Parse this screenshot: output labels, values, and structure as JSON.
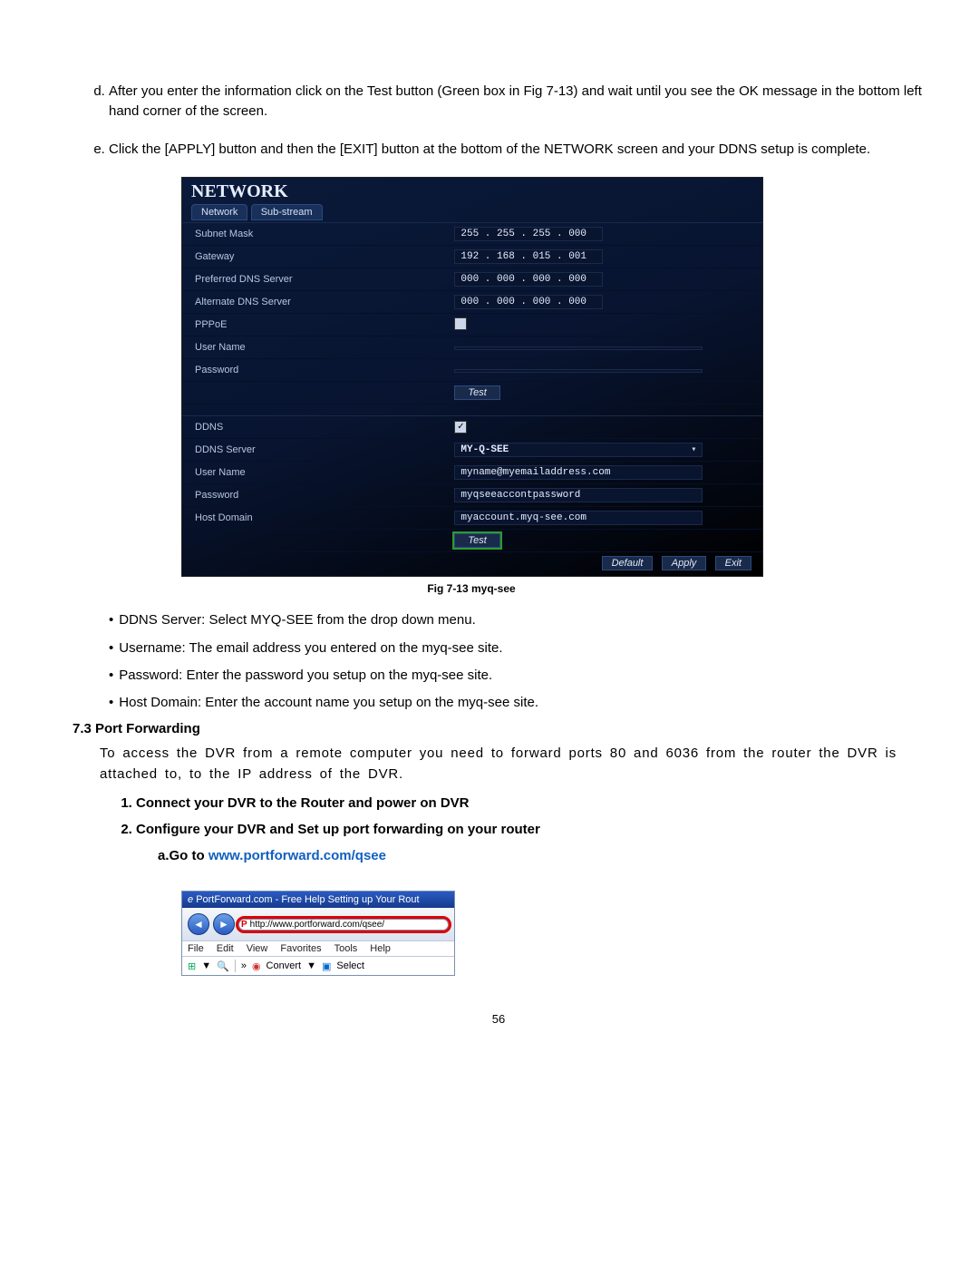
{
  "steps": {
    "d": "After you enter the information click on the Test button (Green box in Fig 7-13) and wait until you see the OK message in the bottom left hand corner of the screen.",
    "e": "Click the [APPLY] button and then the [EXIT] button at the bottom of the NETWORK screen and your DDNS setup is complete."
  },
  "dvr": {
    "title": "NETWORK",
    "tabs": [
      "Network",
      "Sub-stream"
    ],
    "rows": [
      {
        "label": "Subnet Mask",
        "value": "255 . 255 . 255 . 000",
        "seg": true
      },
      {
        "label": "Gateway",
        "value": "192 . 168 . 015 . 001",
        "seg": true
      },
      {
        "label": "Preferred DNS Server",
        "value": "000 . 000 . 000 . 000",
        "seg": true
      },
      {
        "label": "Alternate DNS Server",
        "value": "000 . 000 . 000 . 000",
        "seg": true
      },
      {
        "label": "PPPoE",
        "value": "",
        "chk": true,
        "chkval": ""
      },
      {
        "label": "User Name",
        "value": "",
        "wide": true
      },
      {
        "label": "Password",
        "value": "",
        "wide": true
      }
    ],
    "test1": "Test",
    "ddns": [
      {
        "label": "DDNS",
        "chk": true,
        "chkval": "✓"
      },
      {
        "label": "DDNS Server",
        "value": "MY-Q-SEE",
        "dd": true
      },
      {
        "label": "User Name",
        "value": "myname@myemailaddress.com"
      },
      {
        "label": "Password",
        "value": "myqseeaccontpassword"
      },
      {
        "label": "Host Domain",
        "value": "myaccount.myq-see.com"
      }
    ],
    "test2": "Test",
    "footer": [
      "Default",
      "Apply",
      "Exit"
    ]
  },
  "caption": "Fig 7-13 myq-see",
  "bullets": [
    "DDNS Server: Select MYQ-SEE from the drop down menu.",
    "Username: The email address you entered on the myq-see site.",
    "Password: Enter the password you setup on the myq-see site.",
    "Host Domain: Enter the account name you setup on the myq-see site."
  ],
  "sec73": {
    "heading": "7.3 Port Forwarding",
    "para": "To access the DVR from a remote computer you need to forward ports 80 and 6036 from the router the DVR is attached to, to the IP address of the DVR.",
    "step1": "Connect your DVR to the Router and power on DVR",
    "step2": "Configure your DVR and Set up port forwarding on your router",
    "sub_a_prefix": "a.Go to ",
    "sub_a_link": "www.portforward.com/qsee"
  },
  "browser": {
    "title": "PortForward.com - Free Help Setting up Your Rout",
    "url": "http://www.portforward.com/qsee/",
    "menus": [
      "File",
      "Edit",
      "View",
      "Favorites",
      "Tools",
      "Help"
    ],
    "tools": {
      "more": "»",
      "convert": "Convert",
      "select": "Select",
      "dd": "▼"
    }
  },
  "pagenum": "56"
}
